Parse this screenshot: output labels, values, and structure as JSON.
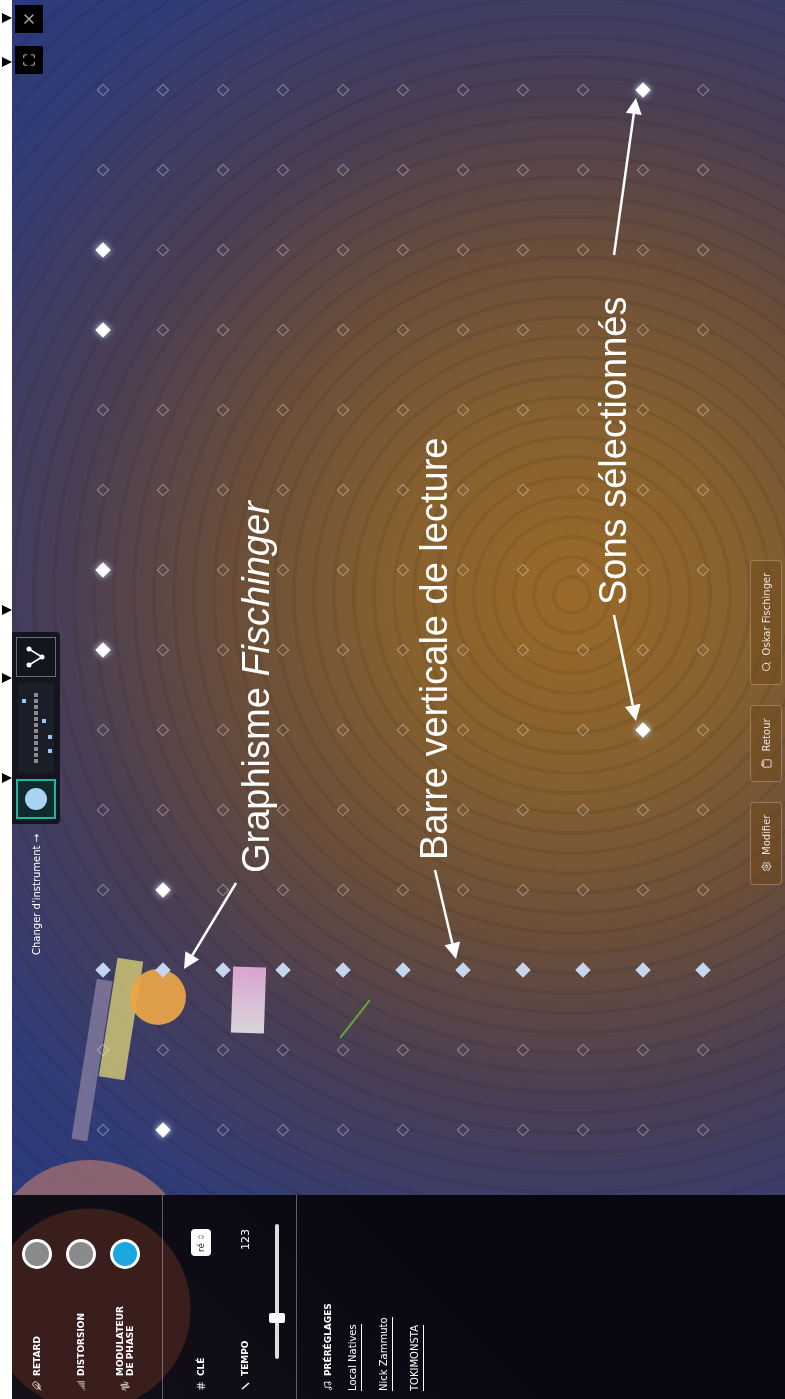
{
  "toolbar": {
    "hint": "Changer d'instrument →",
    "instruments": [
      {
        "kind": "circle",
        "selected": true
      },
      {
        "kind": "nodes",
        "selected": false
      }
    ]
  },
  "effects": [
    {
      "label": "RETARD",
      "kind": "delay",
      "on": false
    },
    {
      "label": "DISTORSION",
      "kind": "distortion",
      "on": false
    },
    {
      "label": "MODULATEUR DE PHASE",
      "kind": "phase",
      "on": true
    }
  ],
  "key": {
    "label": "CLÉ",
    "value": "ré"
  },
  "tempo": {
    "label": "TEMPO",
    "value": "123",
    "level": 0.3
  },
  "presets": {
    "heading": "PRÉRÉGLAGES",
    "items": [
      {
        "label": "Local Natives"
      },
      {
        "label": "Nick Zammuto"
      },
      {
        "label": "TOKIMONSTA"
      }
    ]
  },
  "sequencer": {
    "columns": [
      {
        "playing": false,
        "notes": [
          false,
          true,
          false,
          false,
          false,
          false,
          false,
          false,
          false,
          false,
          false
        ]
      },
      {
        "playing": false,
        "notes": [
          false,
          false,
          false,
          false,
          false,
          false,
          false,
          false,
          false,
          false,
          false
        ]
      },
      {
        "playing": true
      },
      {
        "playing": false,
        "notes": [
          false,
          true,
          false,
          false,
          false,
          false,
          false,
          false,
          false,
          false,
          false
        ]
      },
      {
        "playing": false,
        "notes": [
          false,
          false,
          false,
          false,
          false,
          false,
          false,
          false,
          false,
          false,
          false
        ]
      },
      {
        "playing": false,
        "notes": [
          false,
          false,
          false,
          false,
          false,
          false,
          false,
          false,
          false,
          true,
          false
        ]
      },
      {
        "playing": false,
        "notes": [
          true,
          false,
          false,
          false,
          false,
          false,
          false,
          false,
          false,
          false,
          false
        ]
      },
      {
        "playing": false,
        "notes": [
          true,
          false,
          false,
          false,
          false,
          false,
          false,
          false,
          false,
          false,
          false
        ]
      },
      {
        "playing": false,
        "notes": [
          false,
          false,
          false,
          false,
          false,
          false,
          false,
          false,
          false,
          false,
          false
        ]
      },
      {
        "playing": false,
        "notes": [
          false,
          false,
          false,
          false,
          false,
          false,
          false,
          false,
          false,
          false,
          false
        ]
      },
      {
        "playing": false,
        "notes": [
          true,
          false,
          false,
          false,
          false,
          false,
          false,
          false,
          false,
          false,
          false
        ]
      },
      {
        "playing": false,
        "notes": [
          true,
          false,
          false,
          false,
          false,
          false,
          false,
          false,
          false,
          false,
          false
        ]
      },
      {
        "playing": false,
        "notes": [
          false,
          false,
          false,
          false,
          false,
          false,
          false,
          false,
          false,
          false,
          false
        ]
      },
      {
        "playing": false,
        "notes": [
          false,
          false,
          false,
          false,
          false,
          false,
          false,
          false,
          false,
          true,
          false
        ]
      }
    ]
  },
  "actions": [
    {
      "kind": "edit",
      "label": "Modifier"
    },
    {
      "kind": "back",
      "label": "Retour"
    },
    {
      "kind": "search",
      "label": "Oskar Fischinger"
    }
  ],
  "annotations": [
    {
      "text": "Graphisme *Fischinger*"
    },
    {
      "text": "Barre verticale de lecture"
    },
    {
      "text": "Sons sélectionnés"
    }
  ]
}
